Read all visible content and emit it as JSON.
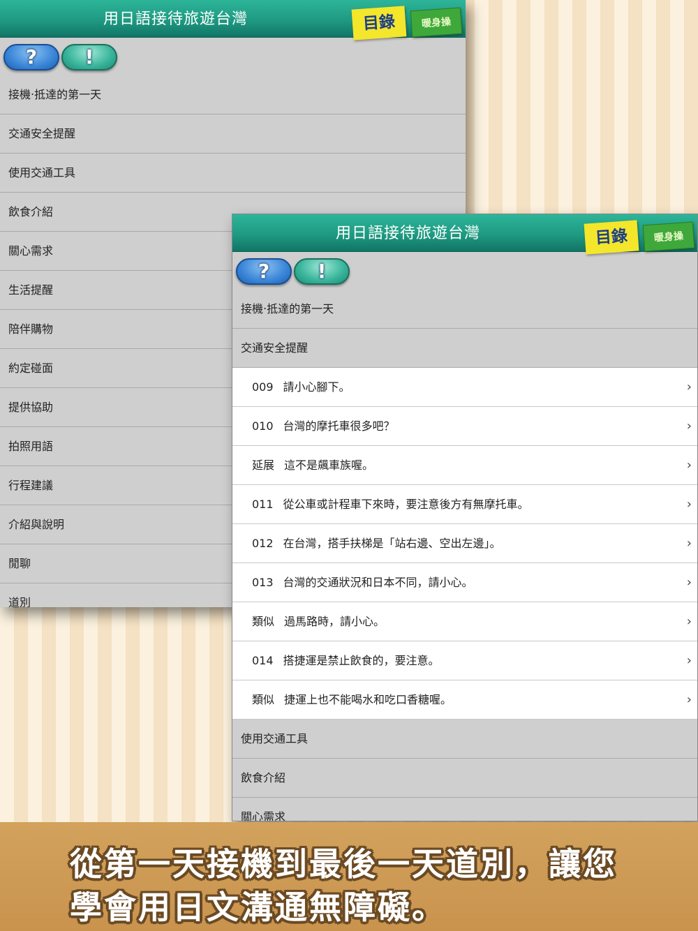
{
  "app_title": "用日語接待旅遊台灣",
  "tag_contents": "目錄",
  "tag_warmup": "暖身操",
  "help_button": "?",
  "info_button": "!",
  "back_screen": {
    "items": [
      "接機‧抵達的第一天",
      "交通安全提醒",
      "使用交通工具",
      "飲食介紹",
      "關心需求",
      "生活提醒",
      "陪伴購物",
      "約定碰面",
      "提供協助",
      "拍照用語",
      "行程建議",
      "介紹與說明",
      "閒聊",
      "道別"
    ]
  },
  "front_screen": {
    "top_items": [
      "接機‧抵達的第一天",
      "交通安全提醒"
    ],
    "expanded_items": [
      {
        "num": "009",
        "text": "請小心腳下。"
      },
      {
        "num": "010",
        "text": "台灣的摩托車很多吧？"
      },
      {
        "num": "延展",
        "text": "這不是飆車族喔。"
      },
      {
        "num": "011",
        "text": "從公車或計程車下來時，要注意後方有無摩托車。"
      },
      {
        "num": "012",
        "text": "在台灣，搭手扶梯是「站右邊、空出左邊」。"
      },
      {
        "num": "013",
        "text": "台灣的交通狀況和日本不同，請小心。"
      },
      {
        "num": "類似",
        "text": "過馬路時，請小心。"
      },
      {
        "num": "014",
        "text": "搭捷運是禁止飲食的，要注意。"
      },
      {
        "num": "類似",
        "text": "捷運上也不能喝水和吃口香糖喔。"
      }
    ],
    "bottom_items": [
      "使用交通工具",
      "飲食介紹",
      "關心需求"
    ],
    "chevron": "›"
  },
  "banner": {
    "line1": "從第一天接機到最後一天道別，讓您",
    "line2": "學會用日文溝通無障礙。"
  }
}
